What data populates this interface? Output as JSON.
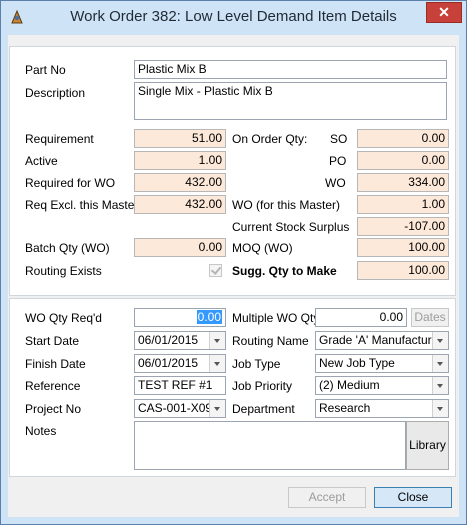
{
  "window": {
    "title": "Work Order 382: Low Level Demand Item Details",
    "icon": "work-order-app-icon",
    "close_label": "✕"
  },
  "item": {
    "part_no_label": "Part No",
    "part_no": "Plastic Mix B",
    "description_label": "Description",
    "description": "Single Mix - Plastic Mix B"
  },
  "demand": {
    "requirement_label": "Requirement",
    "requirement": "51.00",
    "active_label": "Active",
    "active": "1.00",
    "required_for_wo_label": "Required for WO",
    "required_for_wo": "432.00",
    "req_excl_master_label": "Req Excl. this Master",
    "req_excl_master": "432.00",
    "batch_qty_label": "Batch Qty (WO)",
    "batch_qty": "0.00",
    "routing_exists_label": "Routing Exists",
    "routing_exists_checked": true
  },
  "on_order": {
    "on_order_label": "On Order Qty:",
    "so_label": "SO",
    "so": "0.00",
    "po_label": "PO",
    "po": "0.00",
    "wo_label": "WO",
    "wo": "334.00",
    "wo_master_label": "WO (for this Master)",
    "wo_master": "1.00",
    "stock_surplus_label": "Current Stock Surplus",
    "stock_surplus": "-107.00",
    "moq_label": "MOQ (WO)",
    "moq": "100.00",
    "sugg_qty_label": "Sugg. Qty to Make",
    "sugg_qty": "100.00"
  },
  "work_order": {
    "wo_qty_label": "WO Qty Req'd",
    "wo_qty": "0.00",
    "start_date_label": "Start Date",
    "start_date": "06/01/2015",
    "finish_date_label": "Finish Date",
    "finish_date": "06/01/2015",
    "reference_label": "Reference",
    "reference": "TEST REF #1",
    "project_no_label": "Project No",
    "project_no": "CAS-001-X09",
    "notes_label": "Notes",
    "notes": "",
    "multiple_wo_qty_label": "Multiple WO Qty",
    "multiple_wo_qty": "0.00",
    "dates_button": "Dates",
    "routing_name_label": "Routing Name",
    "routing_name": "Grade 'A' Manufacture",
    "job_type_label": "Job Type",
    "job_type": "New Job Type",
    "job_priority_label": "Job Priority",
    "job_priority": "(2) Medium",
    "department_label": "Department",
    "department": "Research",
    "library_button": "Library"
  },
  "footer": {
    "accept_button": "Accept",
    "close_button": "Close"
  }
}
